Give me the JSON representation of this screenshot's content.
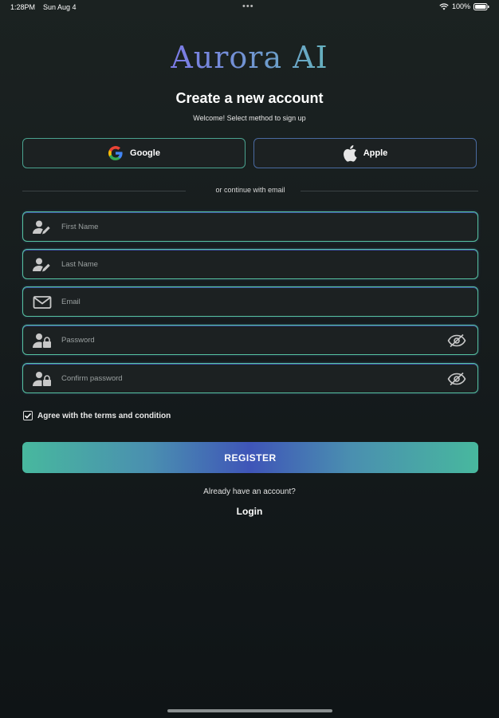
{
  "status_bar": {
    "time": "1:28PM",
    "date": "Sun Aug 4",
    "battery": "100%",
    "icons": [
      "wifi-icon",
      "battery-icon"
    ]
  },
  "header": {
    "logo": "Aurora AI",
    "title": "Create a new account",
    "subtitle": "Welcome! Select method to sign up"
  },
  "social": {
    "google_label": "Google",
    "apple_label": "Apple",
    "google_icon": "google-logo-icon",
    "apple_icon": "apple-logo-icon"
  },
  "divider_text": "or continue with email",
  "form": {
    "first_name": {
      "placeholder": "First Name",
      "value": "",
      "icon": "user-edit-icon"
    },
    "last_name": {
      "placeholder": "Last Name",
      "value": "",
      "icon": "user-edit-icon"
    },
    "email": {
      "placeholder": "Email",
      "value": "",
      "icon": "mail-icon"
    },
    "password": {
      "placeholder": "Password",
      "value": "",
      "icon": "user-lock-icon",
      "toggle_icon": "eye-off-icon"
    },
    "confirm_password": {
      "placeholder": "Confirm password",
      "value": "",
      "icon": "user-lock-icon",
      "toggle_icon": "eye-off-icon"
    }
  },
  "terms": {
    "label": "Agree with the terms and condition",
    "checked": true
  },
  "register_label": "REGISTER",
  "footer": {
    "have_account": "Already have an account?",
    "login_label": "Login"
  },
  "colors": {
    "background": "#161c1d",
    "field_border": "#56c3a0",
    "accent_teal": "#48b89e",
    "accent_blue": "#3f55b8"
  }
}
